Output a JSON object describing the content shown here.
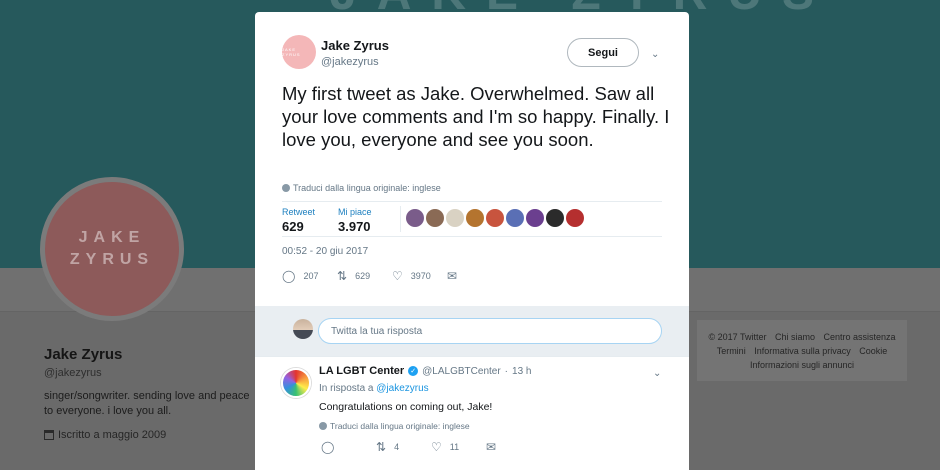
{
  "background": {
    "banner_text": "JAKE ZYRUS",
    "avatar_text_line1": "JAKE",
    "avatar_text_line2": "ZYRUS",
    "name": "Jake Zyrus",
    "handle": "@jakezyrus",
    "bio": "singer/songwriter. sending love and peace to everyone. i love you all.",
    "joined": "Iscritto a maggio 2009",
    "footer_links": [
      "© 2017 Twitter",
      "Chi siamo",
      "Centro assistenza",
      "Termini",
      "Informativa sulla privacy",
      "Cookie",
      "Informazioni sugli annunci"
    ]
  },
  "tweet": {
    "author_name": "Jake Zyrus",
    "author_handle": "@jakezyrus",
    "avatar_text": "JAKE ZYRUS",
    "follow_label": "Segui",
    "text": "My first tweet as Jake. Overwhelmed. Saw all your love comments and I'm so happy. Finally. I love you, everyone and see you soon.",
    "translate": "Traduci dalla lingua originale: inglese",
    "retweet_label": "Retweet",
    "retweet_count": "629",
    "like_label": "Mi piace",
    "like_count": "3.970",
    "liker_colors": [
      "#7a5c8a",
      "#8a6a55",
      "#d9d2c3",
      "#b4742f",
      "#c8543e",
      "#5a6fb5",
      "#6b3f8f",
      "#2b2b2b",
      "#b52f2f"
    ],
    "timestamp": "00:52 - 20 giu 2017",
    "reply_count": "207",
    "retweets": "629",
    "likes": "3970"
  },
  "reply_box": {
    "placeholder": "Twitta la tua risposta"
  },
  "reply_tweet": {
    "name": "LA LGBT Center",
    "handle": "@LALGBTCenter",
    "time": "13 h",
    "reply_to_prefix": "In risposta a",
    "reply_to_handle": "@jakezyrus",
    "text": "Congratulations on coming out, Jake!",
    "translate": "Traduci dalla lingua originale: inglese",
    "retweets": "4",
    "likes": "11"
  }
}
